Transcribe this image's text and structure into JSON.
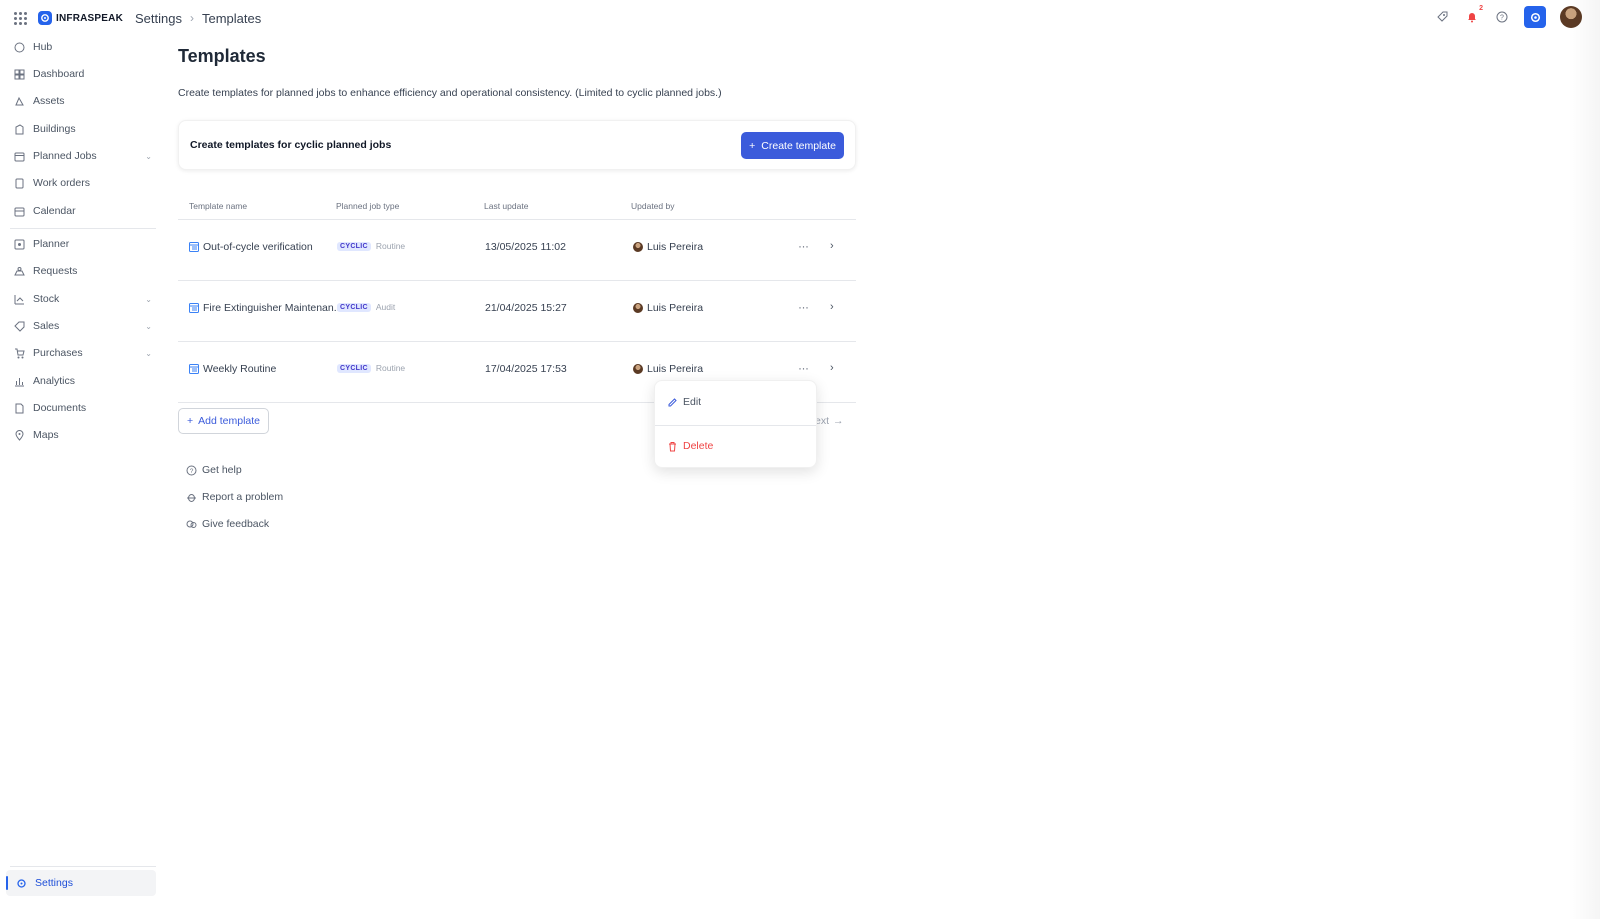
{
  "brand": {
    "name": "INFRASPEAK"
  },
  "breadcrumb": {
    "section": "Settings",
    "page": "Templates"
  },
  "topbar": {
    "notification_count": "2"
  },
  "sidebar": {
    "items": [
      {
        "label": "Hub",
        "icon": "hub-icon"
      },
      {
        "label": "Dashboard",
        "icon": "dashboard-icon"
      },
      {
        "label": "Assets",
        "icon": "assets-icon"
      },
      {
        "label": "Buildings",
        "icon": "buildings-icon"
      },
      {
        "label": "Planned Jobs",
        "icon": "planned-jobs-icon",
        "expandable": true
      },
      {
        "label": "Work orders",
        "icon": "work-orders-icon"
      },
      {
        "label": "Calendar",
        "icon": "calendar-icon"
      },
      {
        "label": "Planner",
        "icon": "planner-icon"
      },
      {
        "label": "Requests",
        "icon": "requests-icon"
      },
      {
        "label": "Stock",
        "icon": "stock-icon",
        "expandable": true
      },
      {
        "label": "Sales",
        "icon": "sales-icon",
        "expandable": true
      },
      {
        "label": "Purchases",
        "icon": "purchases-icon",
        "expandable": true
      },
      {
        "label": "Analytics",
        "icon": "analytics-icon"
      },
      {
        "label": "Documents",
        "icon": "documents-icon"
      },
      {
        "label": "Maps",
        "icon": "maps-icon"
      }
    ],
    "settings_label": "Settings"
  },
  "page": {
    "title": "Templates",
    "description": "Create templates for planned jobs to enhance efficiency and operational consistency. (Limited to cyclic planned jobs.)",
    "card_text": "Create templates for cyclic planned jobs",
    "create_button": "Create template"
  },
  "table": {
    "columns": [
      "Template name",
      "Planned job type",
      "Last update",
      "Updated by"
    ],
    "rows": [
      {
        "name": "Out-of-cycle verification",
        "tag": "CYCLIC",
        "type": "Routine",
        "updated": "13/05/2025 11:02",
        "by": "Luis Pereira"
      },
      {
        "name": "Fire Extinguisher Maintenan...",
        "tag": "CYCLIC",
        "type": "Audit",
        "updated": "21/04/2025 15:27",
        "by": "Luis Pereira"
      },
      {
        "name": "Weekly Routine",
        "tag": "CYCLIC",
        "type": "Routine",
        "updated": "17/04/2025 17:53",
        "by": "Luis Pereira"
      }
    ]
  },
  "actions": {
    "add_template": "Add template",
    "next": "ext"
  },
  "help": {
    "get_help": "Get help",
    "report": "Report a problem",
    "feedback": "Give feedback"
  },
  "menu": {
    "edit": "Edit",
    "delete": "Delete"
  },
  "colors": {
    "accent": "#3b5bdb",
    "danger": "#ef4444"
  }
}
